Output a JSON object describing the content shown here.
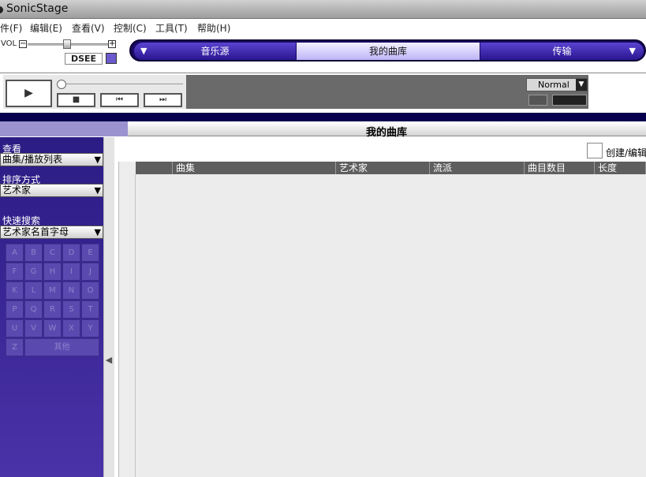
{
  "window": {
    "title": "SonicStage"
  },
  "menu": [
    "件(F)",
    "编辑(E)",
    "查看(V)",
    "控制(C)",
    "工具(T)",
    "帮助(H)"
  ],
  "volume": {
    "label": "VOL",
    "minus": "−",
    "plus": "+",
    "level": 0.5
  },
  "dsee": {
    "label": "DSEE"
  },
  "source_tabs": [
    {
      "label": "音乐源",
      "arrow": "▼"
    },
    {
      "label": "我的曲库",
      "selected": true
    },
    {
      "label": "传输",
      "arrow": "▼"
    }
  ],
  "player": {
    "play": "▶",
    "stop": "■",
    "prev": "⏮",
    "next": "⏭",
    "mode": "Normal",
    "mode_arrow": "▼"
  },
  "library": {
    "title": "我的曲库"
  },
  "sidebar": {
    "view_label": "查看",
    "view_value": "曲集/播放列表",
    "sort_label": "排序方式",
    "sort_value": "艺术家",
    "quick_label": "快速搜索",
    "quick_value": "艺术家名首字母",
    "dropdown_arrow": "▼",
    "letters": [
      "A",
      "B",
      "C",
      "D",
      "E",
      "F",
      "G",
      "H",
      "I",
      "J",
      "K",
      "L",
      "M",
      "N",
      "O",
      "P",
      "Q",
      "R",
      "S",
      "T",
      "U",
      "V",
      "W",
      "X",
      "Y",
      "Z"
    ],
    "other_label": "其他",
    "collapse_arrow": "◀"
  },
  "content": {
    "create_label": "创建/编辑",
    "columns": [
      "曲集",
      "艺术家",
      "流派",
      "曲目数目",
      "长度"
    ]
  },
  "colors": {
    "accent": "#2b1c84",
    "tab_selected": "#c8c0f8",
    "header_band": "#05004d"
  }
}
